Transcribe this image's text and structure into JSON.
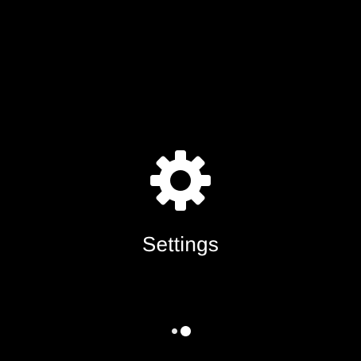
{
  "screen": {
    "background_color": "#000000",
    "foreground_color": "#ffffff"
  },
  "tile": {
    "label": "Settings",
    "icon": "gear-icon"
  },
  "page_indicator": {
    "page_count": 2,
    "current_page": 2
  }
}
